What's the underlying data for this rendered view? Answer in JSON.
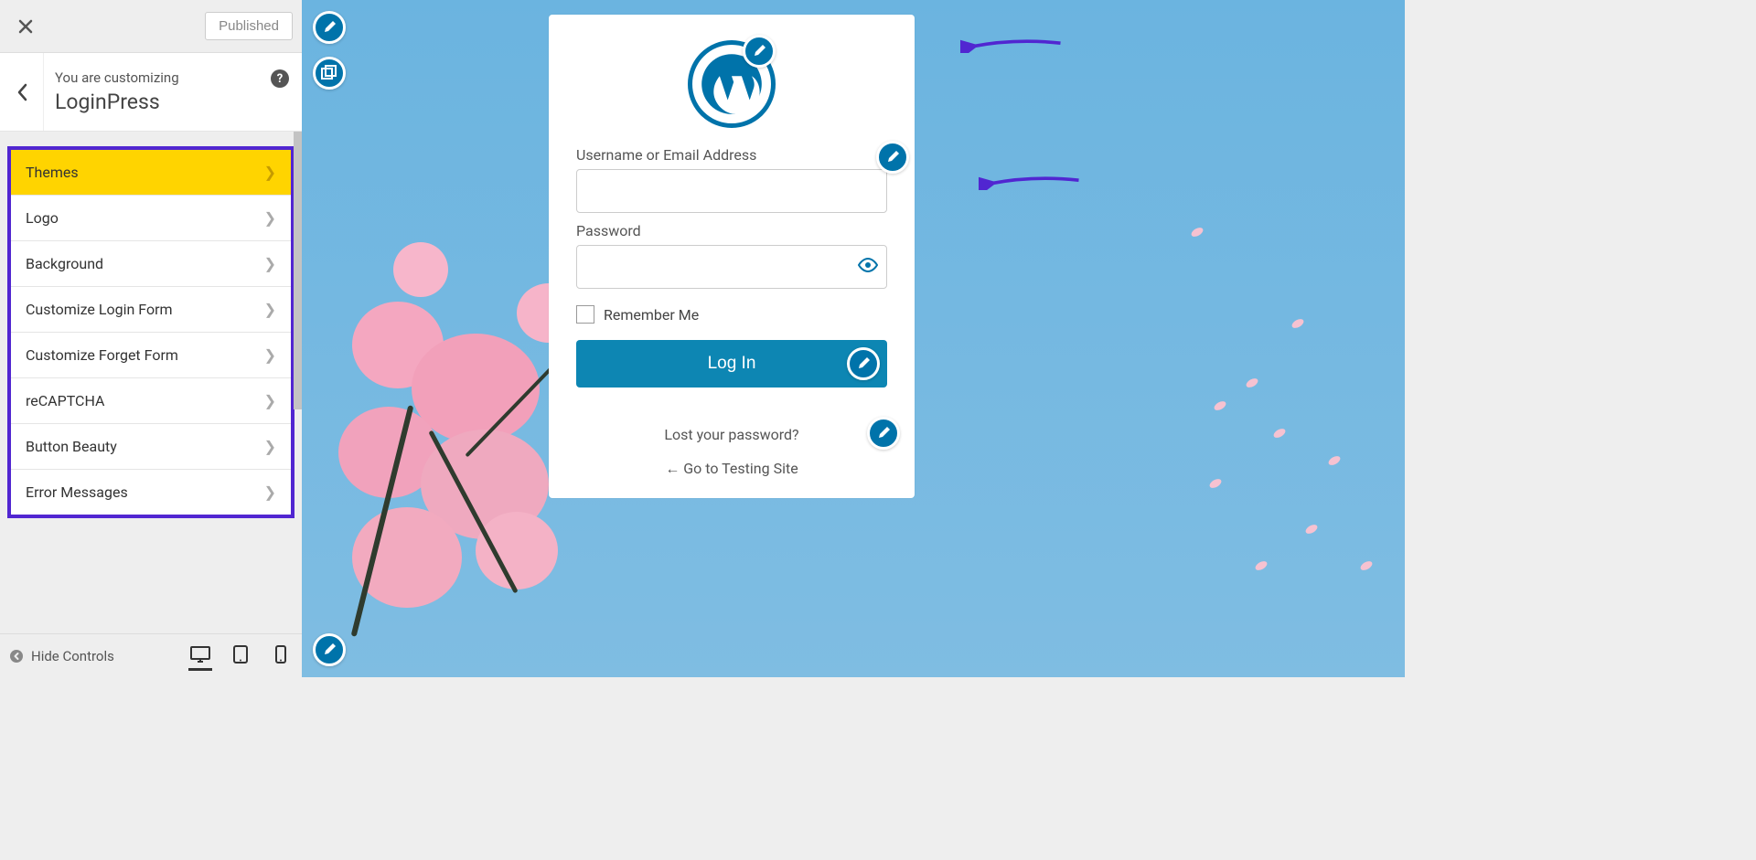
{
  "sidebar": {
    "published_label": "Published",
    "customizing_text": "You are customizing",
    "panel_title": "LoginPress",
    "items": [
      {
        "label": "Themes",
        "active": true
      },
      {
        "label": "Logo"
      },
      {
        "label": "Background"
      },
      {
        "label": "Customize Login Form"
      },
      {
        "label": "Customize Forget Form"
      },
      {
        "label": "reCAPTCHA"
      },
      {
        "label": "Button Beauty"
      },
      {
        "label": "Error Messages"
      }
    ],
    "hide_controls_label": "Hide Controls"
  },
  "login": {
    "username_label": "Username or Email Address",
    "password_label": "Password",
    "remember_label": "Remember Me",
    "login_button": "Log In",
    "lost_password": "Lost your password?",
    "goto_site": "← Go to Testing Site"
  },
  "colors": {
    "accent": "#0073aa",
    "highlight": "#ffd400",
    "annotation": "#5126d1"
  }
}
